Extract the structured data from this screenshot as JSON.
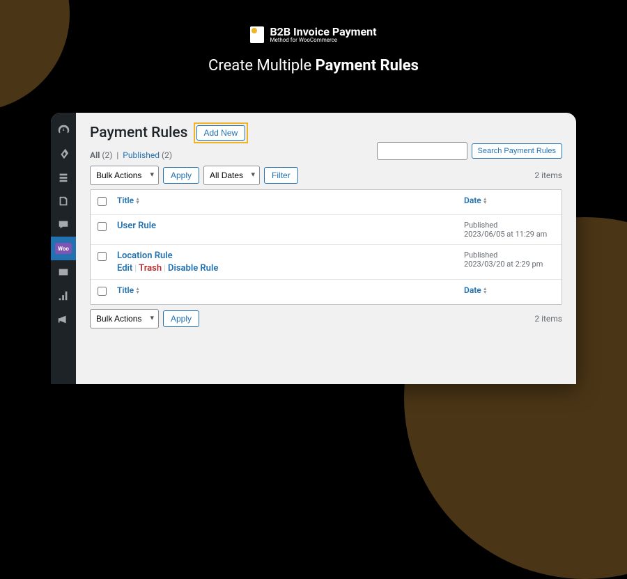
{
  "logo": {
    "main": "B2B Invoice Payment",
    "sub": "Method for WooCommerce"
  },
  "slogan": {
    "light": "Create Multiple ",
    "bold": "Payment Rules"
  },
  "page": {
    "title": "Payment Rules",
    "addNew": "Add New"
  },
  "subsub": {
    "allLabel": "All",
    "allCount": "(2)",
    "publishedLabel": "Published",
    "publishedCount": "(2)"
  },
  "search": {
    "placeholder": "",
    "button": "Search Payment Rules"
  },
  "filters": {
    "bulkActions": "Bulk Actions",
    "apply": "Apply",
    "allDates": "All Dates",
    "filter": "Filter",
    "itemsCount": "2 items"
  },
  "table": {
    "titleHeader": "Title",
    "dateHeader": "Date",
    "rows": [
      {
        "title": "User Rule",
        "status": "Published",
        "date": "2023/06/05 at 11:29 am",
        "showActions": false
      },
      {
        "title": "Location Rule",
        "status": "Published",
        "date": "2023/03/20 at 2:29 pm",
        "showActions": true
      }
    ],
    "actions": {
      "edit": "Edit",
      "trash": "Trash",
      "disable": "Disable Rule"
    }
  }
}
